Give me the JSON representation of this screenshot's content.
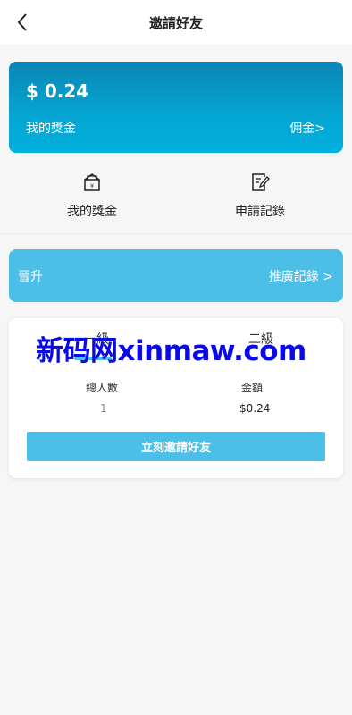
{
  "header": {
    "title": "邀請好友",
    "back_icon": "chevron-left-icon"
  },
  "wallet": {
    "amount": "$ 0.24",
    "label": "我的獎金",
    "commission_link": "佣金>"
  },
  "actions": [
    {
      "label": "我的獎金",
      "icon": "reward-envelope-icon"
    },
    {
      "label": "申請記錄",
      "icon": "edit-document-icon"
    }
  ],
  "promo": {
    "title": "晉升",
    "link": "推廣記錄 >"
  },
  "levels": {
    "tab_one": "一級",
    "tab_two": "二級"
  },
  "stats": {
    "total_people_label": "總人數",
    "total_people_value": "1",
    "amount_label": "金額",
    "amount_value": "$0.24"
  },
  "invite_button": "立刻邀請好友",
  "watermark": "新码网xinmaw.com",
  "colors": {
    "accent": "#4cbfe9",
    "wallet_gradient_top": "#0a86b4",
    "wallet_gradient_bottom": "#00b0de"
  }
}
